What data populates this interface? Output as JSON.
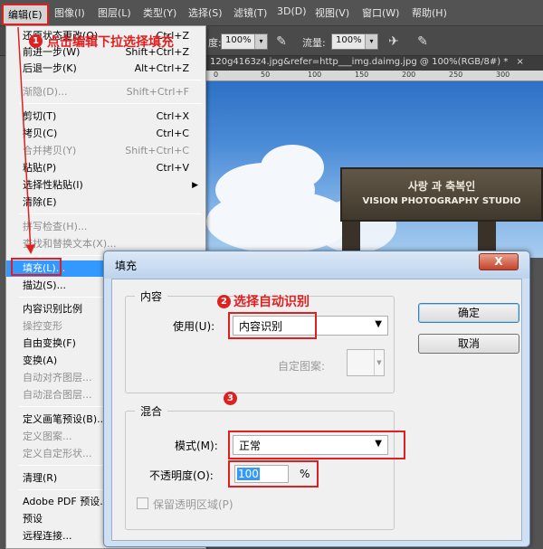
{
  "menubar": {
    "items": [
      "编辑(E)",
      "图像(I)",
      "图层(L)",
      "类型(Y)",
      "选择(S)",
      "滤镜(T)",
      "3D(D)",
      "视图(V)",
      "窗口(W)",
      "帮助(H)"
    ]
  },
  "options": {
    "opacity_label_fragment": "度:",
    "opacity_value": "100%",
    "flow_label": "流量:",
    "flow_value": "100%"
  },
  "document": {
    "tab_title": "120g4163z4.jpg&refer=http___img.daimg.jpg @ 100%(RGB/8#) *",
    "tab_close": "×",
    "ruler_ticks": [
      "0",
      "50",
      "100",
      "150",
      "200",
      "250",
      "300"
    ]
  },
  "canvas": {
    "sign_line1": "사랑 과 축복인",
    "sign_line2": "VISION PHOTOGRAPHY STUDIO"
  },
  "edit_menu": {
    "items": [
      {
        "label": "还原状态更改(O)",
        "shortcut": "Ctrl+Z"
      },
      {
        "label": "前进一步(W)",
        "shortcut": "Shift+Ctrl+Z"
      },
      {
        "label": "后退一步(K)",
        "shortcut": "Alt+Ctrl+Z"
      },
      {
        "label": "渐隐(D)...",
        "shortcut": "Shift+Ctrl+F"
      },
      {
        "label": "剪切(T)",
        "shortcut": "Ctrl+X"
      },
      {
        "label": "拷贝(C)",
        "shortcut": "Ctrl+C"
      },
      {
        "label": "合并拷贝(Y)",
        "shortcut": "Shift+Ctrl+C"
      },
      {
        "label": "粘贴(P)",
        "shortcut": "Ctrl+V"
      },
      {
        "label": "选择性粘贴(I)",
        "shortcut": ""
      },
      {
        "label": "清除(E)",
        "shortcut": ""
      },
      {
        "label": "拼写检查(H)...",
        "shortcut": ""
      },
      {
        "label": "查找和替换文本(X)...",
        "shortcut": ""
      },
      {
        "label": "填充(L)...",
        "shortcut": ""
      },
      {
        "label": "描边(S)...",
        "shortcut": ""
      },
      {
        "label": "内容识别比例",
        "shortcut": ""
      },
      {
        "label": "操控变形",
        "shortcut": ""
      },
      {
        "label": "自由变换(F)",
        "shortcut": ""
      },
      {
        "label": "变换(A)",
        "shortcut": ""
      },
      {
        "label": "自动对齐图层...",
        "shortcut": ""
      },
      {
        "label": "自动混合图层...",
        "shortcut": ""
      },
      {
        "label": "定义画笔预设(B)...",
        "shortcut": ""
      },
      {
        "label": "定义图案...",
        "shortcut": ""
      },
      {
        "label": "定义自定形状...",
        "shortcut": ""
      },
      {
        "label": "清理(R)",
        "shortcut": ""
      },
      {
        "label": "Adobe PDF 预设...",
        "shortcut": ""
      },
      {
        "label": "预设",
        "shortcut": ""
      },
      {
        "label": "远程连接...",
        "shortcut": ""
      }
    ]
  },
  "annotations": {
    "step1_num": "1",
    "step1_text": "点击编辑下拉选择填充",
    "step2_num": "2",
    "step2_text": "选择自动识别",
    "step3_num": "3",
    "color": "#e02020"
  },
  "dialog": {
    "title": "填充",
    "close": "X",
    "content_group": "内容",
    "use_label": "使用(U):",
    "use_value": "内容识别",
    "custom_pattern_label": "自定图案:",
    "blend_group": "混合",
    "mode_label": "模式(M):",
    "mode_value": "正常",
    "opacity_label": "不透明度(O):",
    "opacity_value": "100",
    "opacity_unit": "%",
    "preserve_label": "保留透明区域(P)",
    "ok": "确定",
    "cancel": "取消"
  }
}
